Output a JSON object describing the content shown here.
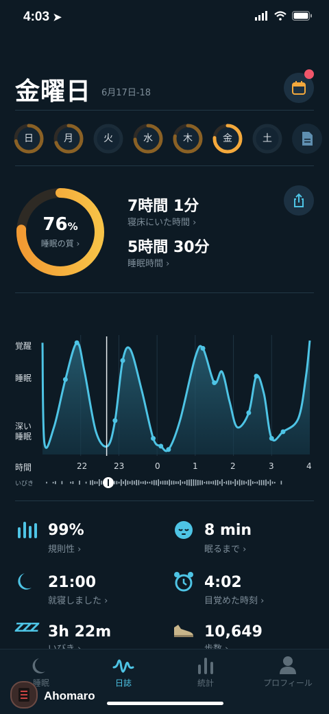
{
  "status_bar": {
    "time": "4:03"
  },
  "header": {
    "title": "金曜日",
    "date_range": "6月17日-18"
  },
  "days": [
    {
      "label": "日",
      "progress": 0.72,
      "active": false
    },
    {
      "label": "月",
      "progress": 0.7,
      "active": false
    },
    {
      "label": "火",
      "progress": 0,
      "active": false
    },
    {
      "label": "水",
      "progress": 0.74,
      "active": false
    },
    {
      "label": "木",
      "progress": 0.78,
      "active": false
    },
    {
      "label": "金",
      "progress": 0.76,
      "active": true
    },
    {
      "label": "土",
      "progress": 0,
      "active": false
    }
  ],
  "summary": {
    "quality_value": "76",
    "quality_unit": "%",
    "quality_label": "睡眠の質 ›",
    "quality_progress": 0.76,
    "time_in_bed": "7時間 1分",
    "time_in_bed_label": "寝床にいた時間 ›",
    "sleep_time": "5時間 30分",
    "sleep_time_label": "睡眠時間 ›"
  },
  "graph": {
    "y_labels": {
      "awake": "覚醒",
      "sleep": "睡眠",
      "deep1": "深い",
      "deep2": "睡眠"
    },
    "x_title": "時間",
    "x_ticks": [
      "22",
      "23",
      "0",
      "1",
      "2",
      "3",
      "4"
    ],
    "snore_label": "いびき"
  },
  "chart_data": {
    "type": "area",
    "x_ticks_hours": [
      22,
      23,
      0,
      1,
      2,
      3,
      4
    ],
    "y_levels": [
      "深い睡眠",
      "睡眠",
      "覚醒"
    ],
    "curve": [
      [
        21.0,
        0.98
      ],
      [
        21.05,
        0.08
      ],
      [
        21.3,
        0.22
      ],
      [
        21.6,
        0.65
      ],
      [
        21.9,
        0.98
      ],
      [
        22.1,
        0.72
      ],
      [
        22.4,
        0.18
      ],
      [
        22.7,
        0.05
      ],
      [
        22.9,
        0.28
      ],
      [
        23.1,
        0.82
      ],
      [
        23.3,
        0.92
      ],
      [
        23.6,
        0.55
      ],
      [
        23.9,
        0.12
      ],
      [
        24.1,
        0.05
      ],
      [
        24.3,
        0.02
      ],
      [
        24.6,
        0.28
      ],
      [
        25.0,
        0.85
      ],
      [
        25.2,
        0.93
      ],
      [
        25.5,
        0.62
      ],
      [
        25.7,
        0.72
      ],
      [
        25.9,
        0.45
      ],
      [
        26.1,
        0.22
      ],
      [
        26.4,
        0.35
      ],
      [
        26.6,
        0.68
      ],
      [
        26.8,
        0.52
      ],
      [
        27.0,
        0.12
      ],
      [
        27.3,
        0.18
      ],
      [
        27.7,
        0.3
      ],
      [
        27.9,
        0.68
      ],
      [
        28.0,
        1.0
      ]
    ]
  },
  "stats": [
    {
      "value": "99%",
      "label": "規則性 ›",
      "icon": "regularity-icon"
    },
    {
      "value": "8 min",
      "label": "眠るまで ›",
      "icon": "sleepy-face-icon"
    },
    {
      "value": "21:00",
      "label": "就寝しました ›",
      "icon": "moon-icon"
    },
    {
      "value": "4:02",
      "label": "目覚めた時刻 ›",
      "icon": "alarm-clock-icon"
    },
    {
      "value": "3h 22m",
      "label": "いびき ›",
      "icon": "zzz-icon"
    },
    {
      "value": "10,649",
      "label": "歩数 ›",
      "icon": "shoe-icon"
    }
  ],
  "tabs": [
    {
      "label": "睡眠",
      "active": false
    },
    {
      "label": "日誌",
      "active": true
    },
    {
      "label": "統計",
      "active": false
    },
    {
      "label": "プロフィール",
      "active": false
    }
  ],
  "overlay": {
    "username": "Ahomaro"
  },
  "colors": {
    "accent": "#f4a93c",
    "track": "#2f2b26",
    "curve": "#4ec4e5",
    "tab_active": "#4ec4e5"
  }
}
